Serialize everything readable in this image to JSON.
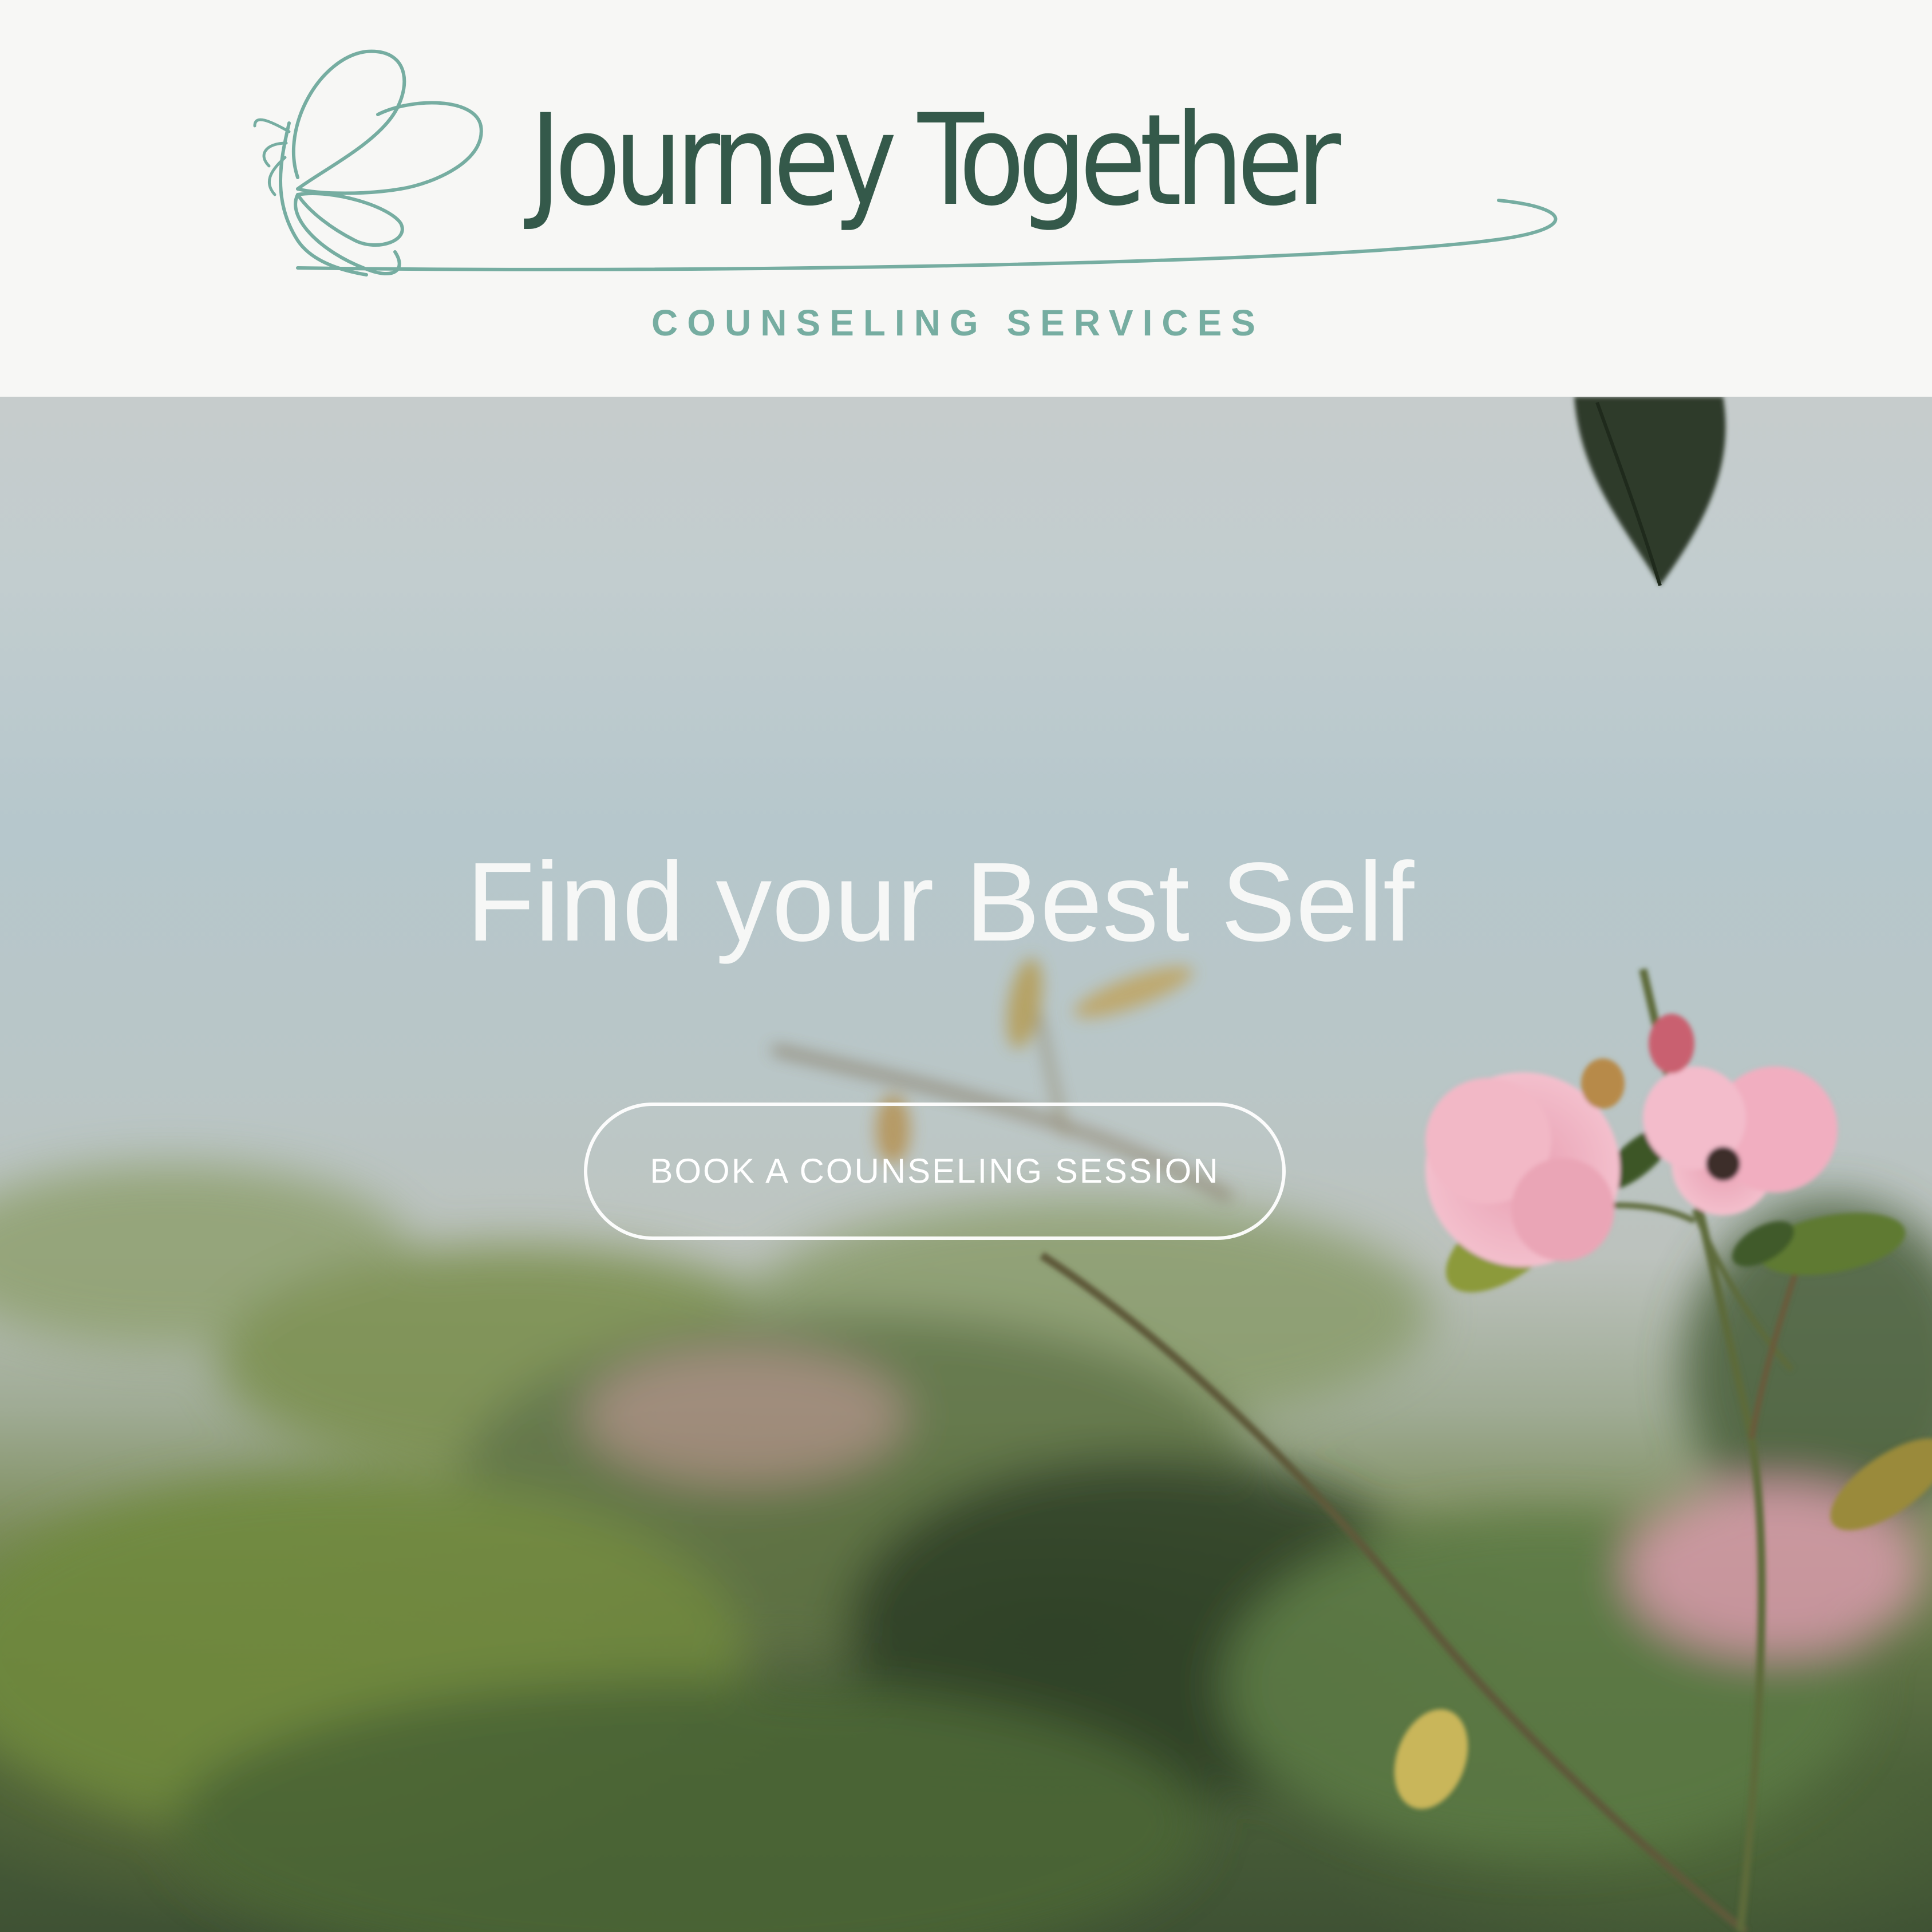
{
  "header": {
    "brand_name": "Journey Together",
    "brand_tagline": "COUNSELING SERVICES",
    "logo_icon": "butterfly-icon"
  },
  "hero": {
    "headline": "Find your Best Self",
    "cta_label": "BOOK A COUNSELING SESSION",
    "background_image": "blurred garden with pink roses on branch"
  },
  "colors": {
    "brand_dark_green": "#34594a",
    "brand_teal": "#76ada1",
    "header_background": "#f7f7f5",
    "hero_text": "#ffffff"
  }
}
